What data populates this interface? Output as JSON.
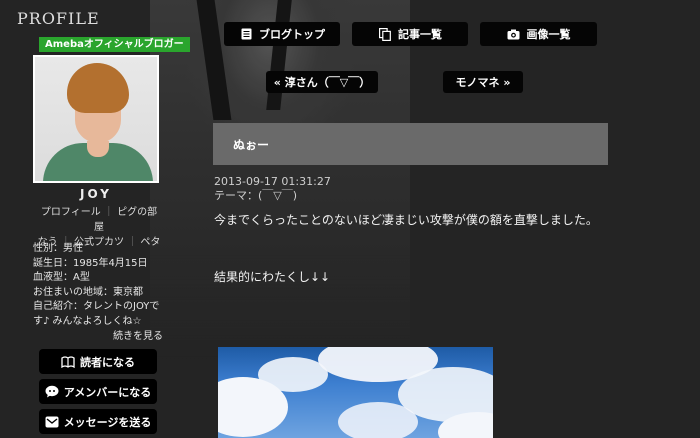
{
  "sidebar": {
    "heading": "PROFILE",
    "badge": "Amebaオフィシャルブロガー",
    "name": "JOY",
    "links": [
      "プロフィール",
      "ピグの部屋",
      "公式プカツ",
      "ペタ"
    ],
    "links_continue": "なう",
    "info": {
      "gender": "性別：男性",
      "birthday": "誕生日：1985年4月15日",
      "blood": "血液型：A型",
      "residence": "お住まいの地域：東京都",
      "intro": "自己紹介：タレントのJOYです♪ みんなよろしくね☆",
      "read_more": "続きを見る"
    },
    "buttons": {
      "follow": "読者になる",
      "amember": "アメンバーになる",
      "message": "メッセージを送る"
    }
  },
  "nav": {
    "blog_top": "ブログトップ",
    "articles": "記事一覧",
    "images": "画像一覧",
    "prev": "« 淳さん（￣▽￣）",
    "next": "モノマネ »"
  },
  "article": {
    "title": "ぬぉー",
    "date": "2013-09-17 01:31:27",
    "theme": "テーマ：(￣▽￣)",
    "body1": "今までくらったことのないほど凄まじい攻撃が僕の額を直撃しました。",
    "body2": "結果的にわたくし↓↓"
  },
  "icons": {
    "blog_top": "document-icon",
    "articles": "copy-icon",
    "images": "camera-icon",
    "follow": "book-icon",
    "amember": "chat-icon",
    "message": "mail-icon"
  },
  "colors": {
    "badge": "#2aa52d",
    "title_bar": "#6a6a6a",
    "button_bg": "#050505",
    "page_bg": "#242424"
  }
}
